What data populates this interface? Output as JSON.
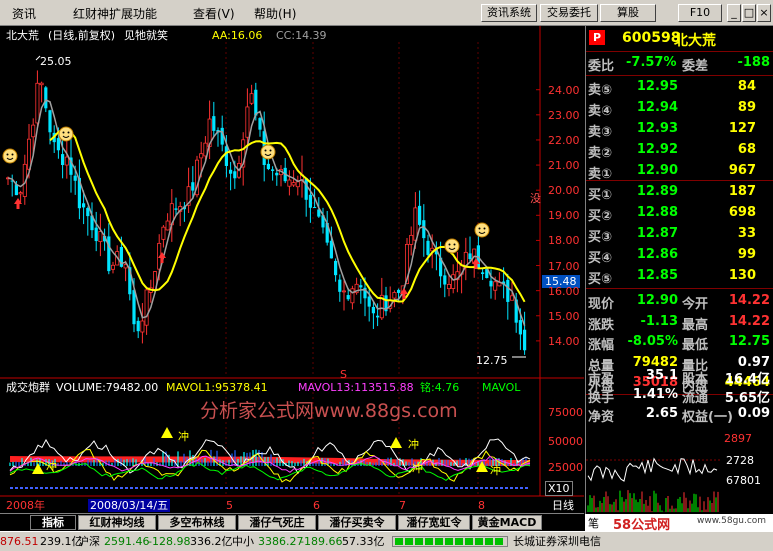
{
  "menu": [
    "资讯",
    "红财神扩展功能",
    "查看(V)",
    "帮助(H)"
  ],
  "toolbar": {
    "buttons": [
      "资讯系统",
      "交易委托",
      "算股",
      "F10"
    ],
    "window_controls": [
      "minimize-icon",
      "maximize-icon",
      "close-icon"
    ]
  },
  "chart": {
    "header": {
      "stock": "北大荒",
      "period": "(日线,前复权)",
      "note": "见牠就笑",
      "aa": "AA:16.06",
      "cc": "CC:14.39"
    },
    "price_axis": [
      "24.00",
      "23.00",
      "22.00",
      "21.00",
      "20.00",
      "19.00",
      "18.00",
      "17.00",
      "16.00",
      "15.00",
      "14.00"
    ],
    "price_range": [
      13.0,
      25.9
    ],
    "current_price_tag": "15.48",
    "high_label": "25.05",
    "low_label": "12.75",
    "side_marker": "没",
    "s_marker": "S",
    "volume_header": {
      "title": "成交炮群",
      "volume": "VOLUME:79482.00",
      "mavol1": "MAVOL1:95378.41",
      "mavol13": "MAVOL13:113515.88",
      "ming": "铭:4.76",
      "mavol": "MAVOL"
    },
    "volume_axis": [
      "75000",
      "50000",
      "25000"
    ],
    "volume_unit": "X10",
    "icon_labels": [
      "冲",
      "冲",
      "冲",
      "冲",
      "冲"
    ],
    "watermark": "分析家公式网www.88gs.com",
    "x_axis": {
      "year": "2008年",
      "date": "2008/03/14/五",
      "months": [
        "5",
        "6",
        "7",
        "8"
      ],
      "period": "日线"
    }
  },
  "tabs": [
    "指标",
    "红财神均线",
    "多空布林线",
    "潘仔气死庄",
    "潘仔买卖令",
    "潘仔宽虹令",
    "黄金MACD"
  ],
  "status": {
    "items": [
      "876.51",
      "239.1亿",
      "沪深",
      "2591.46",
      "-128.98",
      "336.2亿",
      "中小",
      "3386.27",
      "-189.66",
      "57.33亿",
      "长城证券深圳电信"
    ]
  },
  "quote": {
    "code": "600598",
    "name": "北大荒",
    "weibi_label": "委比",
    "weibi": "-7.57%",
    "weicha_label": "委差",
    "weicha": "-188",
    "asks": [
      {
        "label": "卖⑤",
        "price": "12.95",
        "vol": "84"
      },
      {
        "label": "卖④",
        "price": "12.94",
        "vol": "89"
      },
      {
        "label": "卖③",
        "price": "12.93",
        "vol": "127"
      },
      {
        "label": "卖②",
        "price": "12.92",
        "vol": "68"
      },
      {
        "label": "卖①",
        "price": "12.90",
        "vol": "967"
      }
    ],
    "bids": [
      {
        "label": "买①",
        "price": "12.89",
        "vol": "187"
      },
      {
        "label": "买②",
        "price": "12.88",
        "vol": "698"
      },
      {
        "label": "买③",
        "price": "12.87",
        "vol": "33"
      },
      {
        "label": "买④",
        "price": "12.86",
        "vol": "99"
      },
      {
        "label": "买⑤",
        "price": "12.85",
        "vol": "130"
      }
    ],
    "stats": [
      {
        "l1": "现价",
        "v1": "12.90",
        "l2": "今开",
        "v2": "14.22"
      },
      {
        "l1": "涨跌",
        "v1": "-1.13",
        "l2": "最高",
        "v2": "14.22"
      },
      {
        "l1": "涨幅",
        "v1": "-8.05%",
        "l2": "最低",
        "v2": "12.75"
      },
      {
        "l1": "总量",
        "v1": "79482",
        "l2": "量比",
        "v2": "0.97"
      },
      {
        "l1": "外盘",
        "v1": "35018",
        "l2": "内盘",
        "v2": "44464"
      }
    ],
    "fundamentals": [
      {
        "l1": "市盈",
        "v1": "35.1",
        "l2": "股本",
        "v2": "16.4亿"
      },
      {
        "l1": "换手",
        "v1": "1.41%",
        "l2": "流通",
        "v2": "5.65亿"
      },
      {
        "l1": "净资",
        "v1": "2.65",
        "l2": "权益(一)",
        "v2": "0.09"
      }
    ],
    "mini": {
      "top": "2897",
      "mid": "2728",
      "low": "67801"
    },
    "bottom_left": "笔",
    "logo": "58公式网",
    "logo_url": "www.58gu.com"
  },
  "colors": {
    "up": "#ff3232",
    "down": "#00e4ff",
    "ma_yellow": "#ffff00",
    "ma_gray": "#a0a0a0",
    "accent": "#ff0000"
  }
}
